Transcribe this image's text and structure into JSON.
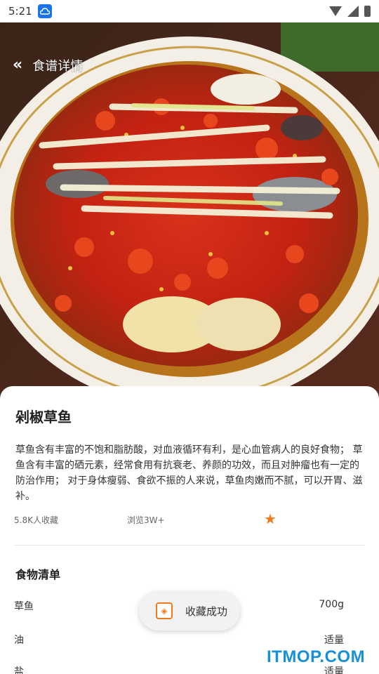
{
  "status_bar": {
    "time": "5:21"
  },
  "header": {
    "back_title": "食谱详情"
  },
  "recipe": {
    "title": "剁椒草鱼",
    "description": "草鱼含有丰富的不饱和脂肪酸，对血液循环有利，是心血管病人的良好食物；  草鱼含有丰富的硒元素，经常食用有抗衰老、养颜的功效，而且对肿瘤也有一定的防治作用；  对于身体瘦弱、食欲不振的人来说，草鱼肉嫩而不腻，可以开胃、滋补。",
    "favorites": "5.8K人收藏",
    "views": "浏览3W+"
  },
  "ingredients": {
    "section_title": "食物清单",
    "items": [
      {
        "name": "草鱼",
        "qty": "700g"
      },
      {
        "name": "油",
        "qty": "适量"
      },
      {
        "name": "盐",
        "qty": "适量"
      }
    ]
  },
  "toast": {
    "text": "收藏成功"
  },
  "watermark": "ITMOP.COM",
  "colors": {
    "accent": "#f07a1a",
    "watermark": "#1890d5"
  }
}
